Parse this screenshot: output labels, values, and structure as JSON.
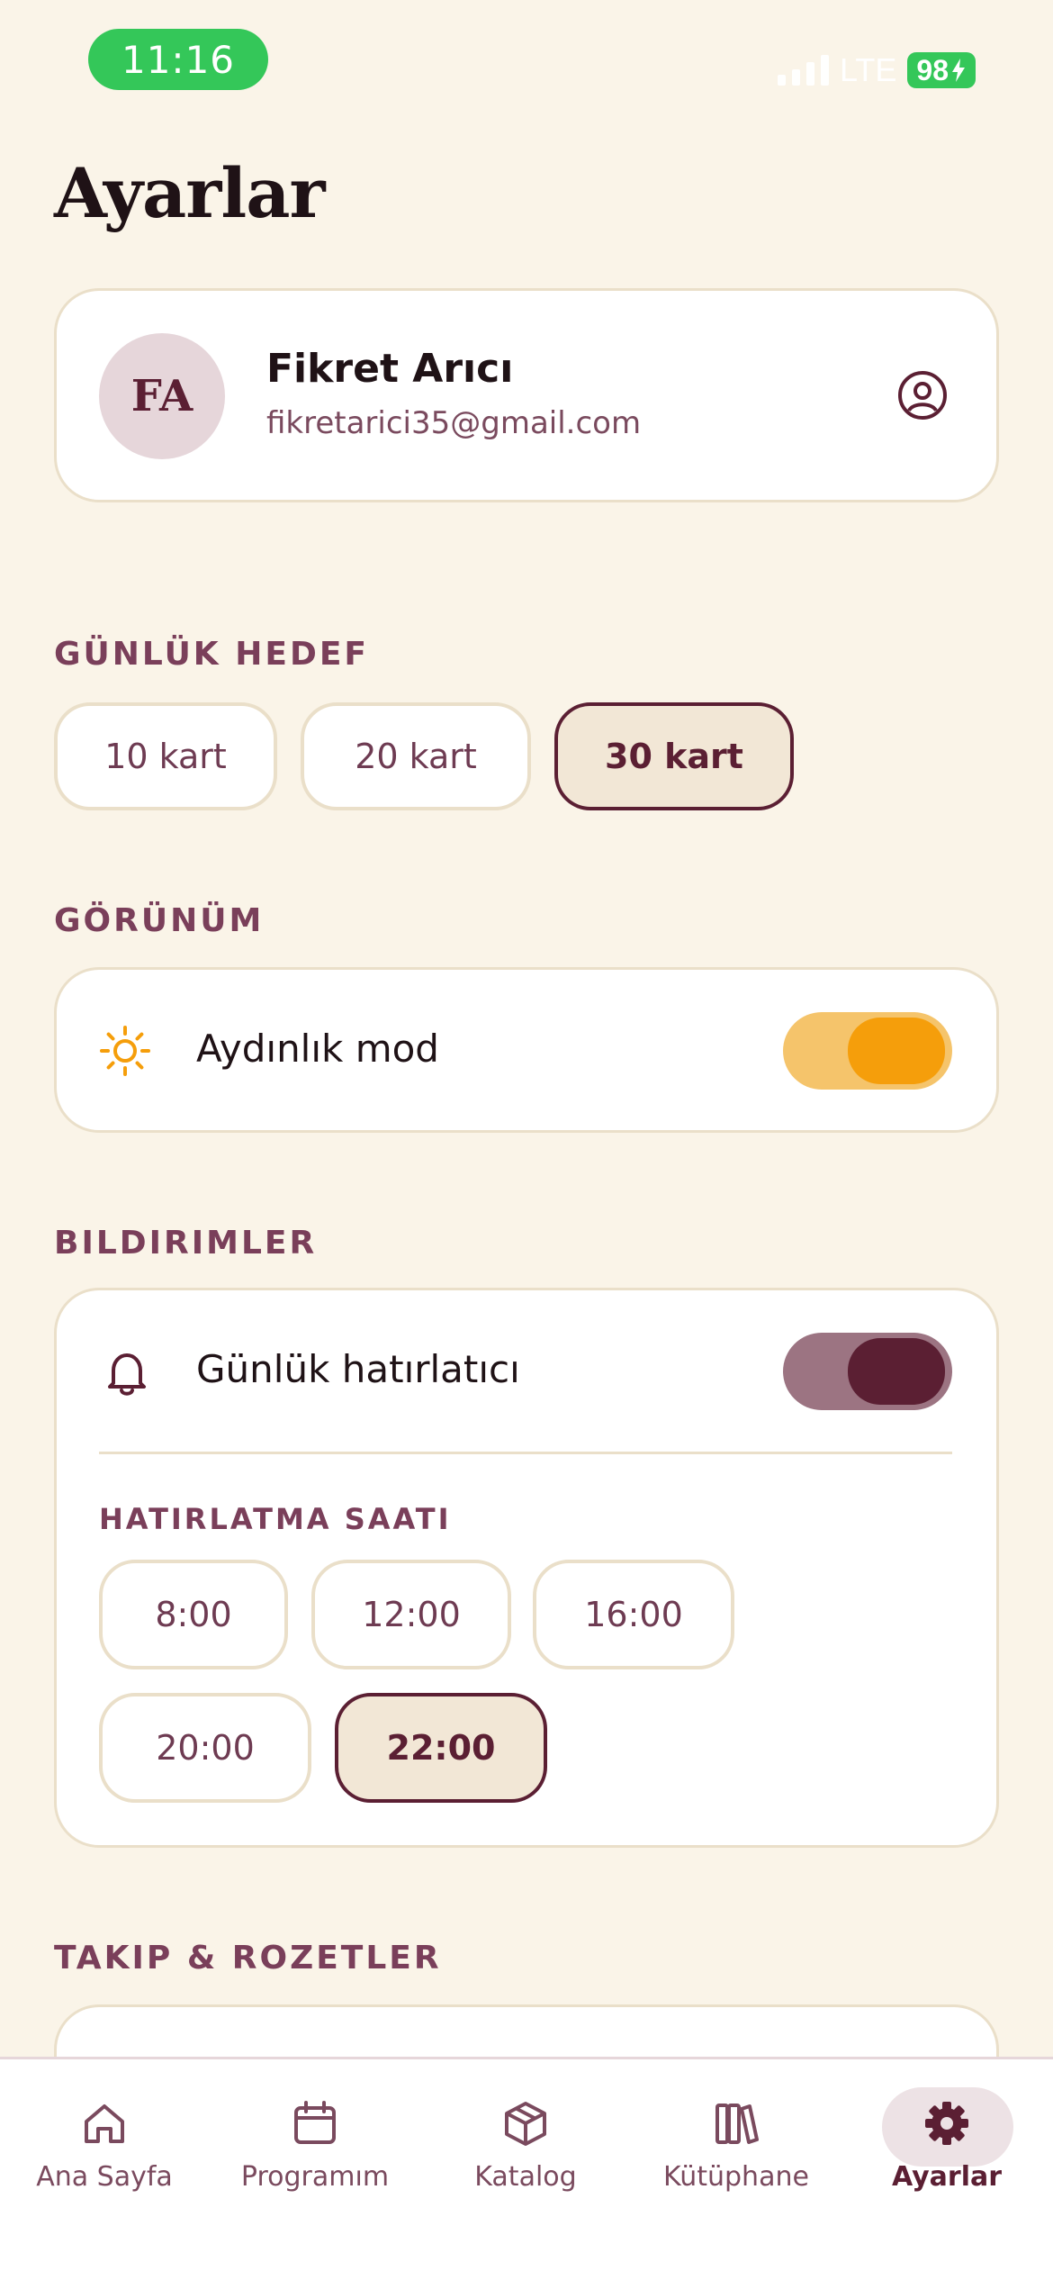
{
  "status_bar": {
    "time": "11:16",
    "network": "LTE",
    "battery": "98"
  },
  "title": "Ayarlar",
  "profile": {
    "initials": "FA",
    "name": "Fikret Arıcı",
    "email": "fikretarici35@gmail.com",
    "icon": "user-circle-icon"
  },
  "daily_goal": {
    "label": "GÜNLÜK HEDEF",
    "options": [
      "10 kart",
      "20 kart",
      "30 kart"
    ],
    "selected": "30 kart"
  },
  "appearance": {
    "label": "GÖRÜNÜM",
    "row_label": "Aydınlık mod",
    "icon": "sun-icon",
    "toggle_on": true,
    "toggle_color": "#F59E0B"
  },
  "notifications": {
    "label": "BILDIRIMLER",
    "row_label": "Günlük hatırlatıcı",
    "icon": "bell-icon",
    "toggle_on": true,
    "toggle_color": "#5B1F33",
    "time_label": "HATIRLATMA SAATI",
    "times": [
      "8:00",
      "12:00",
      "16:00",
      "20:00",
      "22:00"
    ],
    "selected_time": "22:00"
  },
  "follow_section": {
    "label": "TAKIP & ROZETLER"
  },
  "tabs": [
    {
      "label": "Ana Sayfa",
      "icon": "home-icon"
    },
    {
      "label": "Programım",
      "icon": "calendar-icon"
    },
    {
      "label": "Katalog",
      "icon": "box-icon"
    },
    {
      "label": "Kütüphane",
      "icon": "books-icon"
    },
    {
      "label": "Ayarlar",
      "icon": "gear-icon",
      "active": true
    }
  ],
  "colors": {
    "background": "#FAF4E8",
    "accent": "#5B1F33",
    "border": "#EADFC9",
    "label": "#7A3F5A"
  }
}
